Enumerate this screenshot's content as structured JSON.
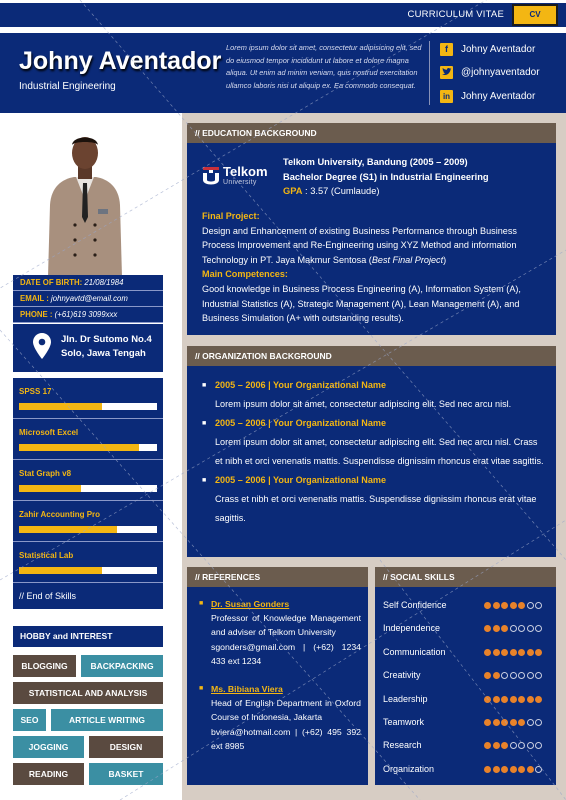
{
  "topbar": {
    "title": "CURRICULUM VITAE",
    "badge": "CV"
  },
  "header": {
    "name": "Johny Aventador",
    "subtitle": "Industrial Engineering",
    "intro": "Lorem ipsum dolor sit amet, consectetur adipisicing elit, sed do eiusmod tempor incididunt ut labore et dolore magna aliqua. Ut enim ad minim veniam, quis nostrud exercitation ullamco laboris nisi ut aliquip ex. Ea commodo consequat.",
    "social": [
      {
        "icon": "facebook-icon",
        "glyph": "f",
        "label": "Johny Aventador"
      },
      {
        "icon": "twitter-icon",
        "glyph": "t",
        "label": "@johnyaventador"
      },
      {
        "icon": "linkedin-icon",
        "glyph": "in",
        "label": "Johny Aventador"
      }
    ]
  },
  "personal": {
    "dob_label": "DATE OF BIRTH:",
    "dob": " 21/08/1984",
    "email_label": "EMAIL :",
    "email": " johnyavtd@email.com",
    "phone_label": "PHONE :",
    "phone": " (+61)619 3099xxx",
    "address_line1": "Jln. Dr Sutomo No.4",
    "address_line2": "Solo, Jawa Tengah"
  },
  "skills": {
    "items": [
      {
        "name": "SPSS 17",
        "level": 0.6
      },
      {
        "name": "Microsoft Excel",
        "level": 0.87
      },
      {
        "name": "Stat Graph v8",
        "level": 0.45
      },
      {
        "name": "Zahir Accounting Pro",
        "level": 0.71
      },
      {
        "name": "Statistical Lab",
        "level": 0.6
      }
    ],
    "end_label": "// End of Skills"
  },
  "hobbies": {
    "title": "HOBBY and INTEREST",
    "tags": [
      "BLOGGING",
      "BACKPACKING",
      "STATISTICAL AND ANALYSIS",
      "SEO",
      "ARTICLE WRITING",
      "JOGGING",
      "DESIGN",
      "READING",
      "BASKET"
    ]
  },
  "education": {
    "title": "// EDUCATION BACKGROUND",
    "logo_main": "Telkom",
    "logo_sub": "University",
    "university": "Telkom University, Bandung (2005 – 2009)",
    "degree": "Bachelor Degree (S1) in Industrial Engineering",
    "gpa_label": "GPA",
    "gpa": " : 3.57 (Cumlaude)",
    "final_project_label": "Final Project:",
    "final_project": "Design and Enhancement of existing Business Performance through Business Process Improvement and Re-Engineering using XYZ Method and information Technology in PT. Jaya Makmur Sentosa (",
    "final_project_note": "Best Final Project",
    "final_project_end": ")",
    "competences_label": "Main Competences:",
    "competences": "Good knowledge in Business Process Engineering (A), Information System (A), Industrial Statistics (A), Strategic Management (A), Lean Management (A),  and Business Simulation (A+ with outstanding results)."
  },
  "organization": {
    "title": "// ORGANIZATION BACKGROUND",
    "items": [
      {
        "heading": "2005 – 2006 | Your Organizational Name",
        "text": "Lorem ipsum dolor sit amet, consectetur adipiscing elit. Sed nec arcu nisl."
      },
      {
        "heading": "2005 – 2006 | Your Organizational Name",
        "text": "Lorem ipsum dolor sit amet, consectetur adipiscing elit. Sed nec arcu nisl. Crass et nibh et orci venenatis mattis. Suspendisse dignissim rhoncus erat vitae sagittis."
      },
      {
        "heading": "2005 – 2006 | Your Organizational Name",
        "text": "Crass et nibh et orci venenatis mattis. Suspendisse dignissim rhoncus erat vitae sagittis."
      }
    ]
  },
  "references": {
    "title": "// REFERENCES",
    "items": [
      {
        "name": "Dr. Susan Gonders",
        "desc": "Professor of Knowledge Management and adviser of Telkom University",
        "contact": "sgonders@gmail.com | (+62) 1234 433 ext 1234"
      },
      {
        "name": "Ms. Bibiana Viera",
        "desc": "Head of English Department in Oxford Course of Indonesia, Jakarta",
        "contact": "bviera@hotmail.com | (+62) 495 392 ext 8985"
      }
    ]
  },
  "social_skills": {
    "title": "// SOCIAL SKILLS",
    "max": 7,
    "items": [
      {
        "name": "Self Confidence",
        "score": 5
      },
      {
        "name": "Independence",
        "score": 3
      },
      {
        "name": "Communication",
        "score": 7
      },
      {
        "name": "Creativity",
        "score": 2
      },
      {
        "name": "Leadership",
        "score": 7
      },
      {
        "name": "Teamwork",
        "score": 5
      },
      {
        "name": "Research",
        "score": 3
      },
      {
        "name": "Organization",
        "score": 6
      }
    ]
  },
  "colors": {
    "navy": "#0b2a78",
    "gold": "#f3b613",
    "brown": "#6b5c4e",
    "teal": "#3b8fa3",
    "dot": "#e8822a"
  }
}
